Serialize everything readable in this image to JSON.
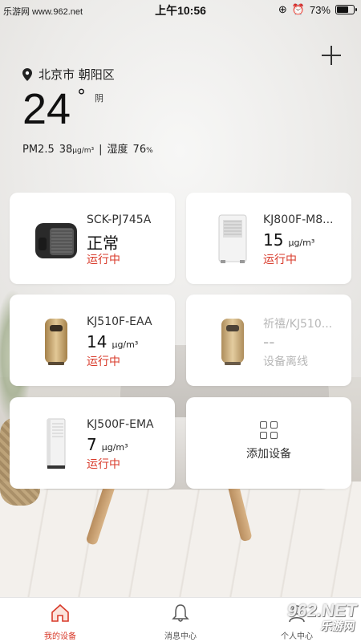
{
  "status_bar": {
    "watermark": "乐游网 www.962.net",
    "time": "上午10:56",
    "battery_percent": "73%",
    "battery_level": 0.73
  },
  "weather": {
    "location": "北京市 朝阳区",
    "temperature": "24",
    "degree": "°",
    "condition": "阴",
    "pm_label": "PM2.5",
    "pm_value": "38",
    "pm_unit": "μg/m³",
    "separator": "|",
    "humidity_label": "湿度",
    "humidity_value": "76",
    "humidity_unit": "%"
  },
  "devices": [
    {
      "model": "SCK-PJ745A",
      "value": "正常",
      "unit": "",
      "status": "运行中",
      "image": "humidifier-black",
      "offline": false
    },
    {
      "model": "KJ800F-M8...",
      "value": "15",
      "unit": "μg/m³",
      "status": "运行中",
      "image": "purifier-white-tall",
      "offline": false
    },
    {
      "model": "KJ510F-EAA",
      "value": "14",
      "unit": "μg/m³",
      "status": "运行中",
      "image": "purifier-gold",
      "offline": false
    },
    {
      "model": "祈禧/KJ510...",
      "value": "--",
      "unit": "",
      "status": "设备离线",
      "image": "purifier-gold",
      "offline": true
    },
    {
      "model": "KJ500F-EMA",
      "value": "7",
      "unit": "μg/m³",
      "status": "运行中",
      "image": "purifier-white-slim",
      "offline": false
    }
  ],
  "add_device": {
    "label": "添加设备",
    "icon": "grid-icon"
  },
  "nav": {
    "items": [
      {
        "label": "我的设备",
        "icon": "home-icon",
        "active": true
      },
      {
        "label": "消息中心",
        "icon": "bell-icon",
        "active": false
      },
      {
        "label": "个人中心",
        "icon": "person-icon",
        "active": false
      }
    ]
  },
  "watermark_bottom": {
    "main": "962.NET",
    "sub": "乐游网"
  },
  "colors": {
    "accent": "#d83a2a",
    "offline": "#b7b7b7"
  }
}
